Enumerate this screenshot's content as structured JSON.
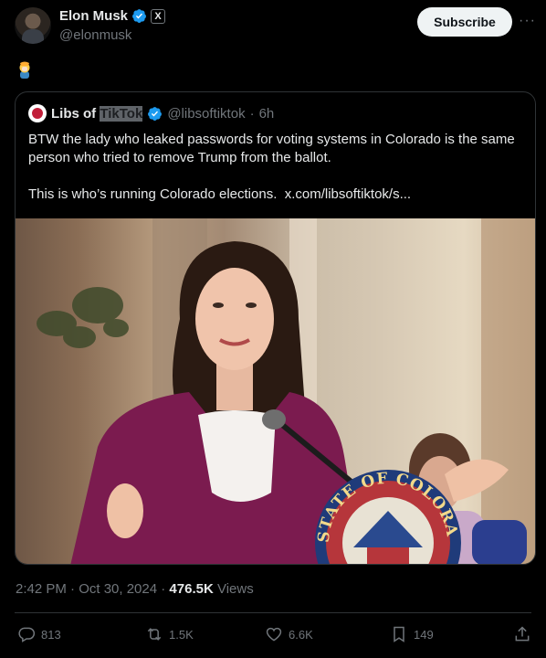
{
  "author": {
    "name": "Elon Musk",
    "handle": "@elonmusk",
    "badge": "X"
  },
  "subscribe_label": "Subscribe",
  "more_label": "···",
  "quoted": {
    "name_prefix": "Libs of",
    "name_highlight": "TikTok",
    "handle": "@libsoftiktok",
    "separator": "·",
    "age": "6h",
    "paragraph1": "BTW the lady who leaked passwords for voting systems in Colorado is the same person who tried to remove Trump from the ballot.",
    "paragraph2": "This is who’s running Colorado elections.",
    "link": "x.com/libsoftiktok/s..."
  },
  "seal_text": "STATE OF COLORADO",
  "meta": {
    "time": "2:42 PM · Oct 30, 2024 · ",
    "views": "476.5K",
    "views_label": " Views"
  },
  "actions": {
    "replies": "813",
    "reposts": "1.5K",
    "likes": "6.6K",
    "bookmarks": "149"
  },
  "colors": {
    "background": "#000000",
    "verified": "#1d9bf0",
    "blazer": "#7b1b4f"
  }
}
